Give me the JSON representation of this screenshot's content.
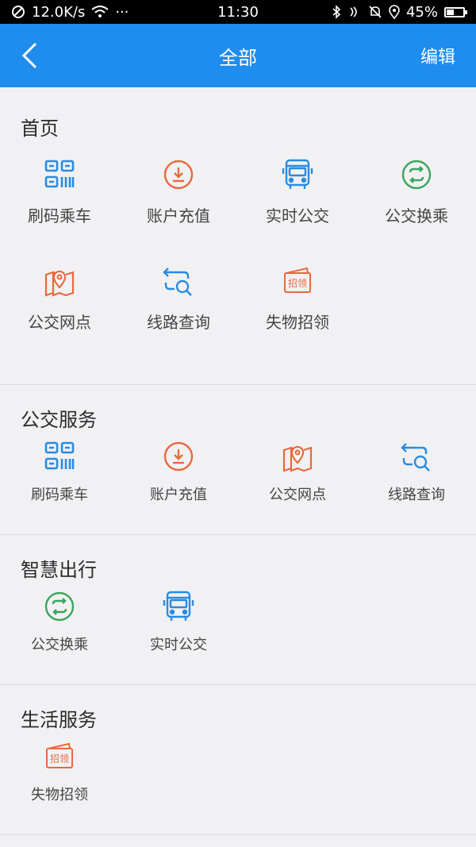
{
  "status_bar": {
    "speed": "12.0K/s",
    "dots": "···",
    "time": "11:30",
    "battery": "45%",
    "battery_level": 0.45
  },
  "nav": {
    "title": "全部",
    "edit_label": "编辑"
  },
  "colors": {
    "primary": "#1f8ded",
    "orange": "#e8693d",
    "green": "#3aa55c",
    "blue": "#2a8be0"
  },
  "sections": {
    "home": {
      "title": "首页",
      "items": [
        {
          "label": "刷码乘车",
          "icon": "qr-code-icon"
        },
        {
          "label": "账户充值",
          "icon": "download-circle-icon"
        },
        {
          "label": "实时公交",
          "icon": "bus-icon"
        },
        {
          "label": "公交换乘",
          "icon": "transfer-cycle-icon"
        },
        {
          "label": "公交网点",
          "icon": "map-pin-icon"
        },
        {
          "label": "线路查询",
          "icon": "route-search-icon"
        },
        {
          "label": "失物招领",
          "icon": "lost-found-icon"
        }
      ]
    },
    "bus_service": {
      "title": "公交服务",
      "items": [
        {
          "label": "刷码乘车",
          "icon": "qr-code-icon"
        },
        {
          "label": "账户充值",
          "icon": "download-circle-icon"
        },
        {
          "label": "公交网点",
          "icon": "map-pin-icon"
        },
        {
          "label": "线路查询",
          "icon": "route-search-icon"
        }
      ]
    },
    "smart_travel": {
      "title": "智慧出行",
      "items": [
        {
          "label": "公交换乘",
          "icon": "transfer-cycle-icon"
        },
        {
          "label": "实时公交",
          "icon": "bus-icon"
        }
      ]
    },
    "life_service": {
      "title": "生活服务",
      "items": [
        {
          "label": "失物招领",
          "icon": "lost-found-icon"
        }
      ]
    }
  },
  "lost_found_stamp": "招领"
}
